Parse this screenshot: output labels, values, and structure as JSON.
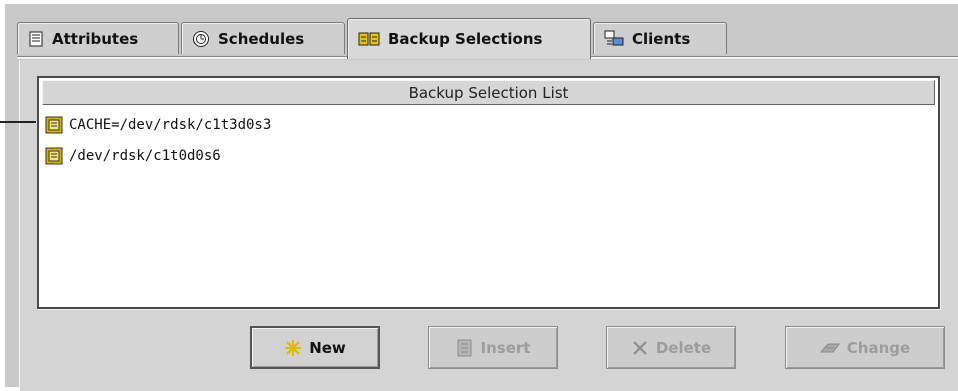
{
  "tabs": [
    {
      "label": "Attributes",
      "icon": "attributes-icon",
      "active": false
    },
    {
      "label": "Schedules",
      "icon": "schedules-icon",
      "active": false
    },
    {
      "label": "Backup Selections",
      "icon": "backup-selections-icon",
      "active": true
    },
    {
      "label": "Clients",
      "icon": "clients-icon",
      "active": false
    }
  ],
  "list": {
    "header": "Backup Selection List",
    "items": [
      {
        "text": "CACHE=/dev/rdsk/c1t3d0s3",
        "icon": "file-entry-icon"
      },
      {
        "text": "/dev/rdsk/c1t0d0s6",
        "icon": "file-entry-icon"
      }
    ]
  },
  "buttons": {
    "new": {
      "label": "New",
      "icon": "new-star-icon",
      "enabled": true
    },
    "insert": {
      "label": "Insert",
      "icon": "insert-icon",
      "enabled": false
    },
    "delete": {
      "label": "Delete",
      "icon": "delete-x-icon",
      "enabled": false
    },
    "change": {
      "label": "Change",
      "icon": "change-icon",
      "enabled": false
    }
  },
  "colors": {
    "panel_bg": "#c9c9c9",
    "list_bg": "#ffffff",
    "file_icon": "#d8b400"
  }
}
